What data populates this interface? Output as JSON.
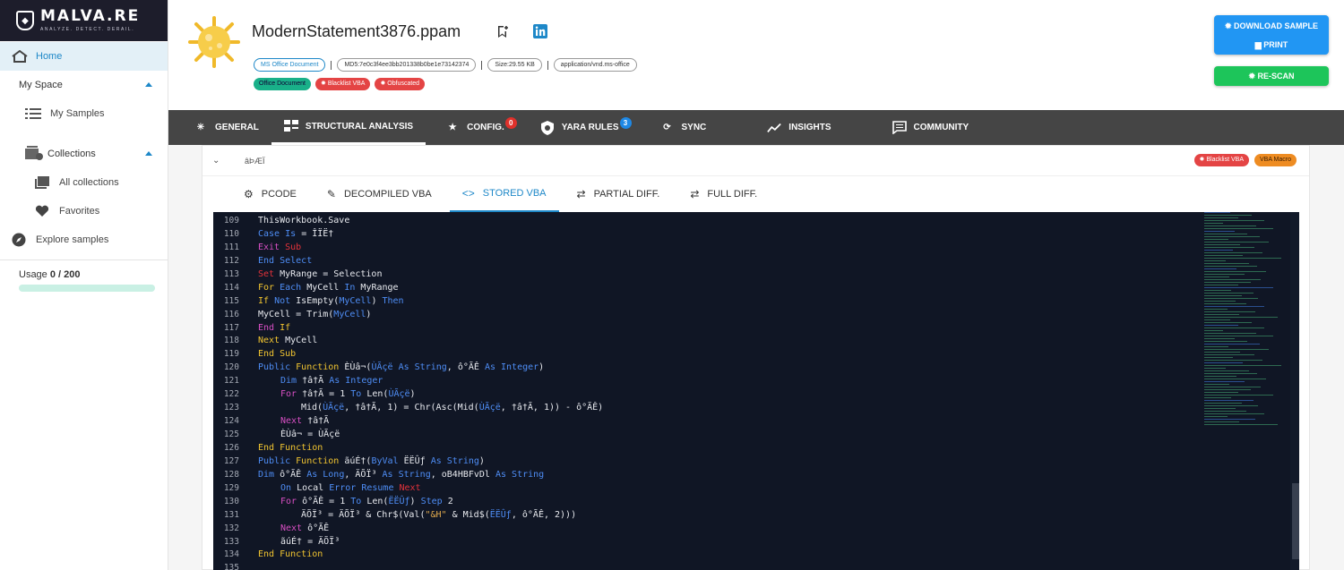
{
  "app": {
    "logo_text": "MALVA.RE",
    "logo_tagline": "ANALYZE. DETECT. DERAIL."
  },
  "sidebar": {
    "home": "Home",
    "my_space": "My Space",
    "my_samples": "My Samples",
    "collections": "Collections",
    "all_collections": "All collections",
    "favorites": "Favorites",
    "explore": "Explore samples",
    "usage_label": "Usage",
    "usage_value": "0 / 200",
    "usage_fraction": 0
  },
  "header": {
    "file_name": "ModernStatement3876.ppam",
    "chips": {
      "type": "MS Office Document",
      "md5": "MD5:7e0c3f4ee3bb201338b0be1e73142374",
      "size": "Size:29.55 KB",
      "mime": "application/vnd.ms-office"
    },
    "tags": [
      "Office Document",
      "Blacklist VBA",
      "Obfuscated"
    ],
    "download_label": "DOWNLOAD SAMPLE",
    "print_label": "PRINT",
    "rescan_label": "RE-SCAN"
  },
  "main_tabs": [
    {
      "label": "GENERAL"
    },
    {
      "label": "STRUCTURAL ANALYSIS"
    },
    {
      "label": "CONFIG.",
      "badge": "0"
    },
    {
      "label": "YARA RULES",
      "badge": "3"
    },
    {
      "label": "SYNC"
    },
    {
      "label": "INSIGHTS"
    },
    {
      "label": "COMMUNITY"
    }
  ],
  "section": {
    "title": "âÞÆÏ",
    "tags": [
      "Blacklist VBA",
      "VBA Macro"
    ]
  },
  "sub_tabs": [
    {
      "label": "PCODE"
    },
    {
      "label": "DECOMPILED VBA"
    },
    {
      "label": "STORED VBA"
    },
    {
      "label": "PARTIAL DIFF."
    },
    {
      "label": "FULL DIFF."
    }
  ],
  "code": {
    "line_numbers": [
      "109",
      "110",
      "111",
      "112",
      "113",
      "114",
      "115",
      "116",
      "117",
      "118",
      "119",
      "120",
      "121",
      "122",
      "123",
      "124",
      "125",
      "126",
      "127",
      "128",
      "129",
      "130",
      "131",
      "132",
      "133",
      "134",
      "135"
    ]
  },
  "colors": {
    "accent": "#1e88c8",
    "tab_bar": "#454545",
    "editor_bg": "#101625",
    "tag_red": "#e44444",
    "tag_green": "#19b089",
    "tag_orange": "#ee8c22",
    "download_btn": "#2196f3",
    "rescan_btn": "#1dc55a"
  }
}
